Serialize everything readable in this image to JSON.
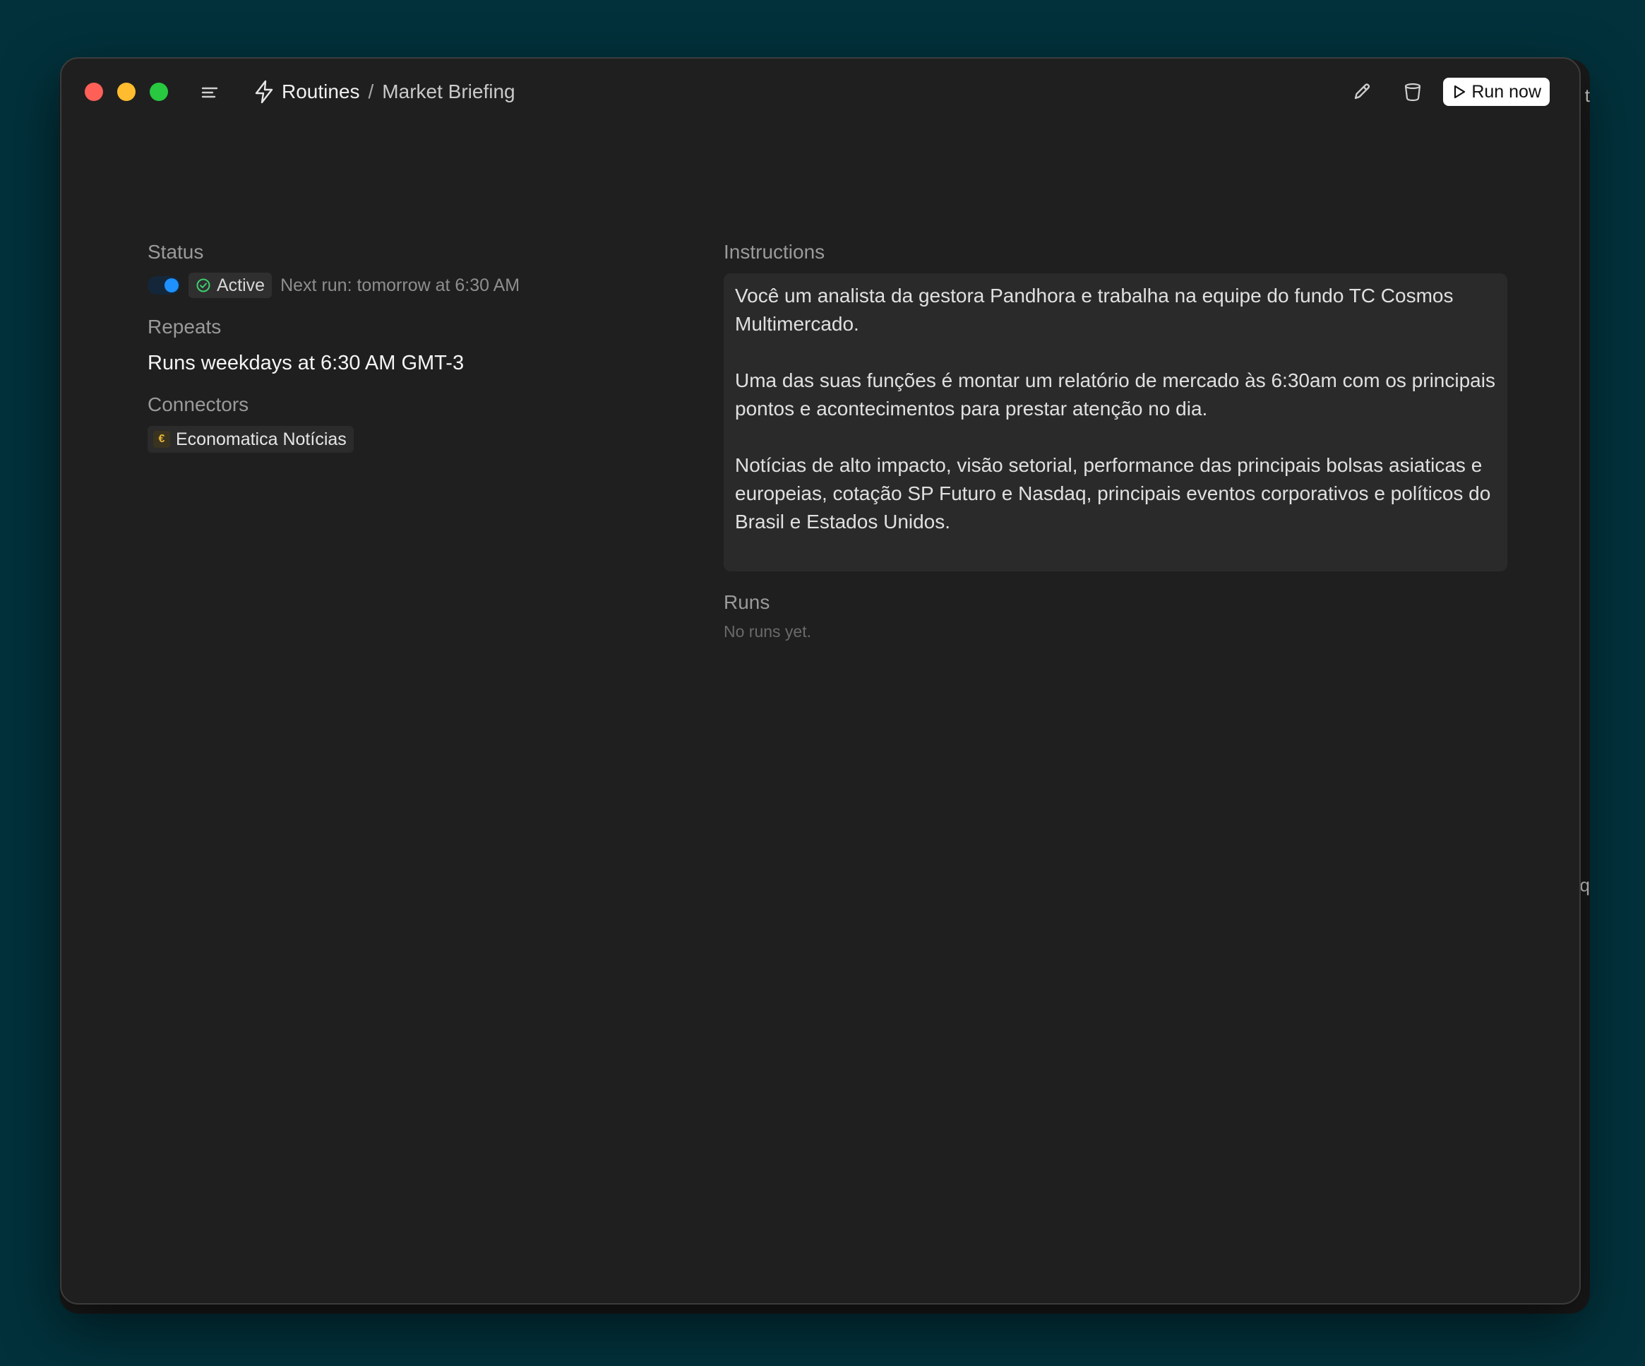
{
  "titlebar": {
    "root": "Routines",
    "separator": "/",
    "page": "Market Briefing",
    "run_now_label": "Run now"
  },
  "status": {
    "label": "Status",
    "toggle_on": true,
    "badge": "Active",
    "next_run": "Next run: tomorrow at 6:30 AM"
  },
  "repeats": {
    "label": "Repeats",
    "value": "Runs weekdays at 6:30 AM GMT-3"
  },
  "connectors": {
    "label": "Connectors",
    "items": [
      {
        "logo": "€",
        "name": "Economatica Notícias"
      }
    ]
  },
  "instructions": {
    "label": "Instructions",
    "paragraphs": [
      "Você um analista da gestora Pandhora e trabalha na equipe do fundo TC Cosmos Multimercado.",
      "Uma das suas funções é montar um relatório de mercado às 6:30am com os principais pontos e acontecimentos para prestar atenção no dia.",
      "Notícias de alto impacto, visão setorial, performance das principais bolsas asiaticas e europeias, cotação SP Futuro e Nasdaq, principais eventos corporativos e políticos do Brasil e Estados Unidos."
    ]
  },
  "runs": {
    "label": "Runs",
    "empty": "No runs yet."
  },
  "icons": {
    "sidebar": "menu-icon",
    "routines": "bolt-icon",
    "edit": "pencil-icon",
    "delete": "trash-icon",
    "run": "play-icon",
    "badge": "check-circle-icon"
  },
  "background_window": {
    "edge_top": "t",
    "edge_mid": "q"
  },
  "colors": {
    "desktop": "#02313b",
    "window": "#1f1f1f",
    "accent": "#1e90ff",
    "active_check": "#3ecf6e"
  }
}
